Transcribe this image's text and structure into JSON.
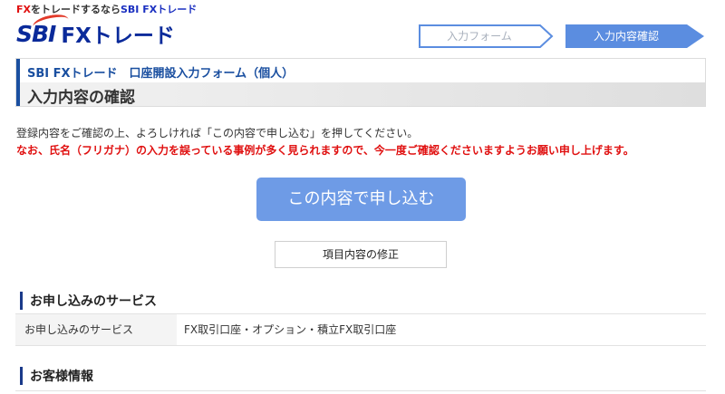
{
  "header": {
    "tagline": {
      "part1": "FX",
      "part2": "をトレードするなら",
      "part3": "SBI FXトレード"
    },
    "logo": {
      "sbi": "SBI",
      "fx": "FXトレード"
    }
  },
  "steps": [
    {
      "label": "入力フォーム",
      "active": false
    },
    {
      "label": "入力内容確認",
      "active": true
    }
  ],
  "title": {
    "subtitle": "SBI FXトレード　口座開設入力フォーム（個人）",
    "main": "入力内容の確認"
  },
  "notices": {
    "instruction": "登録内容をご確認の上、よろしければ「この内容で申し込む」を押してください。",
    "warning": "なお、氏名（フリガナ）の入力を誤っている事例が多く見られますので、今一度ご確認くださいますようお願い申し上げます。"
  },
  "buttons": {
    "submit": "この内容で申し込む",
    "edit": "項目内容の修正"
  },
  "sections": {
    "service": {
      "heading": "お申し込みのサービス",
      "rows": [
        {
          "label": "お申し込みのサービス",
          "value": "FX取引口座・オプション・積立FX取引口座"
        }
      ]
    },
    "customer": {
      "heading": "お客様情報"
    }
  },
  "colors": {
    "brand_blue": "#0a2a9a",
    "accent_red": "#e01010",
    "button_blue": "#6e9be6",
    "step_active": "#5b8de0"
  }
}
